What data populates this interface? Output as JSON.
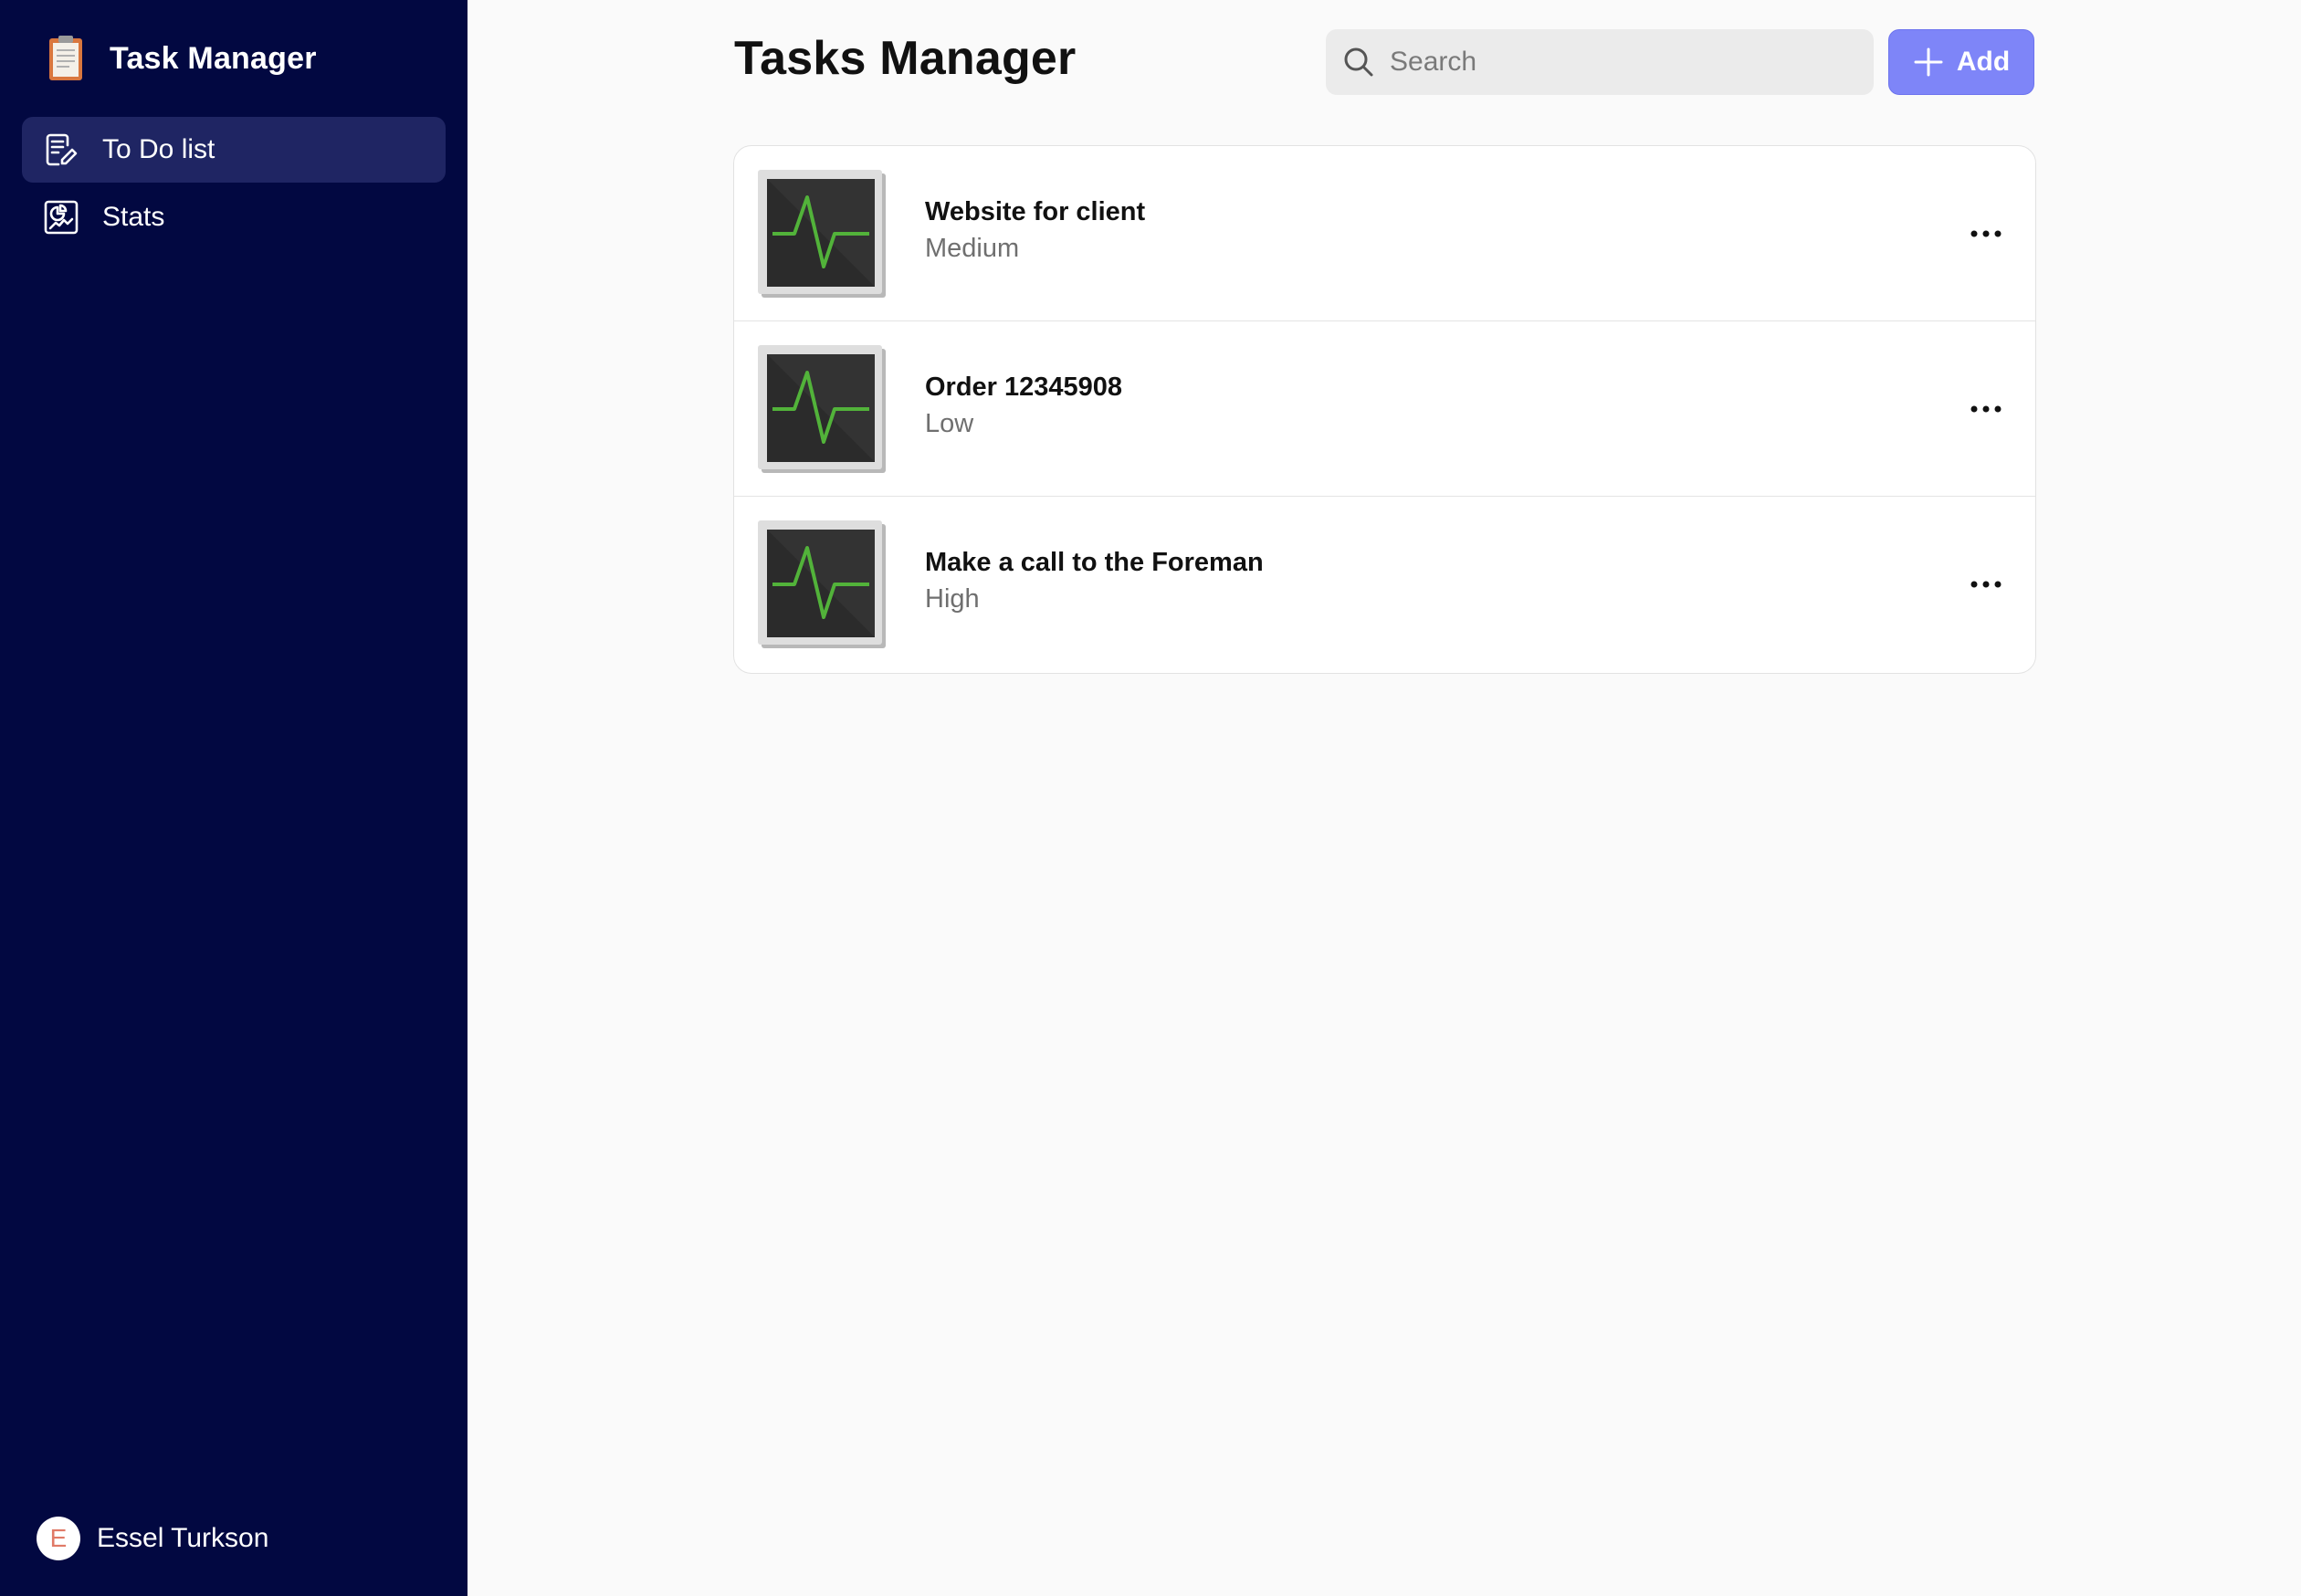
{
  "app": {
    "title": "Task Manager"
  },
  "sidebar": {
    "items": [
      {
        "label": "To Do list",
        "icon": "edit-list-icon",
        "active": true
      },
      {
        "label": "Stats",
        "icon": "stats-chart-icon",
        "active": false
      }
    ],
    "user": {
      "initial": "E",
      "name": "Essel Turkson"
    }
  },
  "header": {
    "title": "Tasks Manager",
    "search": {
      "placeholder": "Search",
      "value": ""
    },
    "add_label": "Add"
  },
  "tasks": [
    {
      "title": "Website for client",
      "priority": "Medium",
      "icon": "activity-monitor-icon"
    },
    {
      "title": "Order 12345908",
      "priority": "Low",
      "icon": "activity-monitor-icon"
    },
    {
      "title": "Make a call to the Foreman",
      "priority": "High",
      "icon": "activity-monitor-icon"
    }
  ],
  "colors": {
    "sidebar_bg": "#020841",
    "sidebar_active": "#1f2563",
    "accent": "#7e85f8",
    "page_bg": "#fafafa",
    "pulse_green": "#52b33a"
  }
}
